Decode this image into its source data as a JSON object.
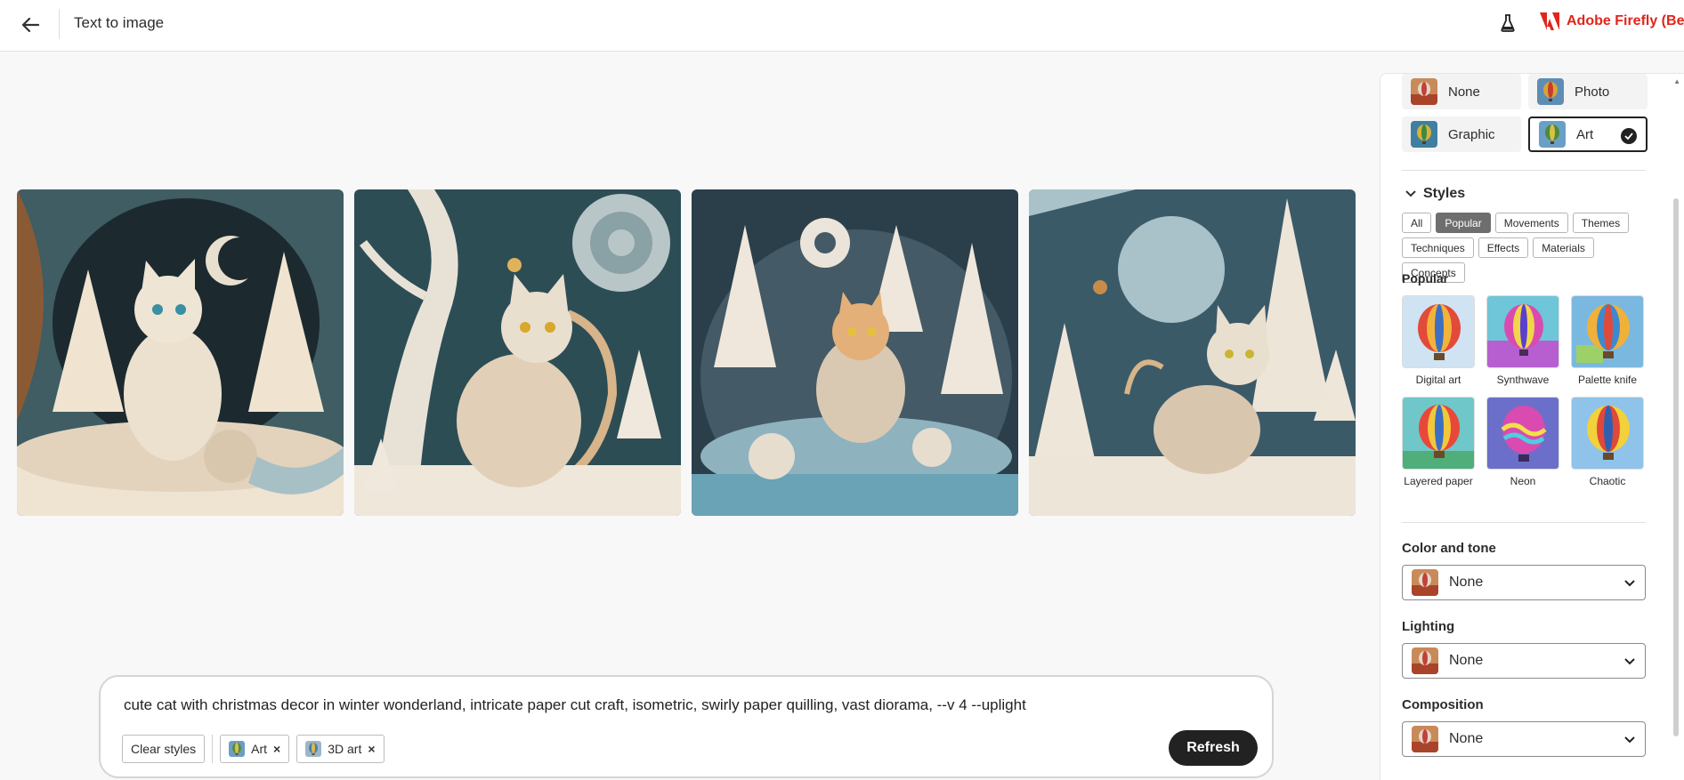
{
  "header": {
    "back_label": "Back",
    "title": "Text to image",
    "brand_name": "Adobe Firefly (Beta)",
    "brand_color": "#e1251b"
  },
  "gallery": {
    "images": [
      {
        "name": "generated-image-1",
        "palette": [
          "#3f5d63",
          "#c9895a",
          "#efe3d2"
        ]
      },
      {
        "name": "generated-image-2",
        "palette": [
          "#2d4d55",
          "#d8b48a",
          "#f1ebe2"
        ]
      },
      {
        "name": "generated-image-3",
        "palette": [
          "#2b3f4b",
          "#8eb2be",
          "#efe6da"
        ]
      },
      {
        "name": "generated-image-4",
        "palette": [
          "#3b5a68",
          "#a9c1c9",
          "#eee5d9"
        ]
      }
    ]
  },
  "prompt": {
    "text": "cute cat with christmas decor in winter wonderland, intricate paper cut craft, isometric, swirly paper quilling, vast diorama, --v 4 --uplight",
    "clear_label": "Clear styles",
    "chips": [
      {
        "label": "Art",
        "remove": "×"
      },
      {
        "label": "3D art",
        "remove": "×"
      }
    ],
    "refresh_label": "Refresh"
  },
  "panel": {
    "content_types": [
      {
        "label": "None",
        "selected": false
      },
      {
        "label": "Photo",
        "selected": false
      },
      {
        "label": "Graphic",
        "selected": false
      },
      {
        "label": "Art",
        "selected": true
      }
    ],
    "styles": {
      "title": "Styles",
      "tabs": [
        "All",
        "Popular",
        "Movements",
        "Themes",
        "Techniques",
        "Effects",
        "Materials",
        "Concepts"
      ],
      "active_tab": "Popular",
      "section_label": "Popular",
      "items": [
        {
          "label": "Digital art"
        },
        {
          "label": "Synthwave"
        },
        {
          "label": "Palette knife"
        },
        {
          "label": "Layered paper"
        },
        {
          "label": "Neon"
        },
        {
          "label": "Chaotic"
        }
      ]
    },
    "color_tone": {
      "label": "Color and tone",
      "value": "None"
    },
    "lighting": {
      "label": "Lighting",
      "value": "None"
    },
    "composition": {
      "label": "Composition",
      "value": "None"
    }
  }
}
